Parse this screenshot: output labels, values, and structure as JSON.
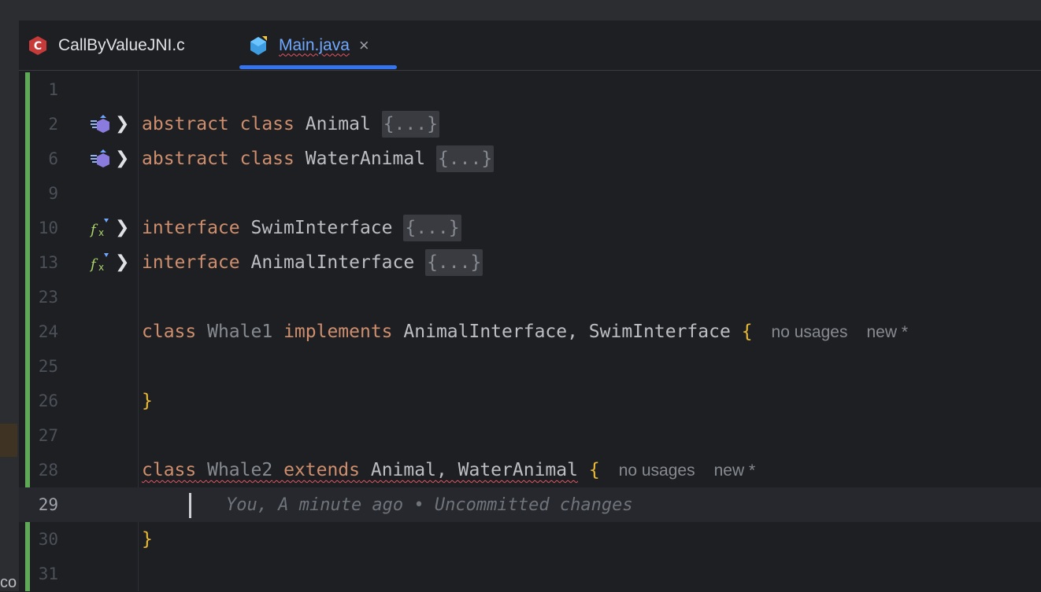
{
  "tabs": [
    {
      "label": "CallByValueJNI.c",
      "icon": "c-file-icon",
      "active": false
    },
    {
      "label": "Main.java",
      "icon": "java-file-icon",
      "active": true,
      "close_glyph": "×"
    }
  ],
  "left_strip": {
    "text": "co"
  },
  "editor": {
    "lines": [
      {
        "n": "1"
      },
      {
        "n": "2",
        "kw1": "abstract",
        "kw2": "class",
        "name": "Animal",
        "fold": "{...}"
      },
      {
        "n": "6",
        "kw1": "abstract",
        "kw2": "class",
        "name": "WaterAnimal",
        "fold": "{...}"
      },
      {
        "n": "9"
      },
      {
        "n": "10",
        "kw1": "interface",
        "name": "SwimInterface",
        "fold": "{...}"
      },
      {
        "n": "13",
        "kw1": "interface",
        "name": "AnimalInterface",
        "fold": "{...}"
      },
      {
        "n": "23"
      },
      {
        "n": "24",
        "kw1": "class",
        "name": "Whale1",
        "kw2": "implements",
        "rest": "AnimalInterface, SwimInterface",
        "brace": "{",
        "usages": "no usages",
        "status": "new *"
      },
      {
        "n": "25"
      },
      {
        "n": "26",
        "brace": "}"
      },
      {
        "n": "27"
      },
      {
        "n": "28",
        "kw1": "class",
        "name": "Whale2",
        "kw2": "extends",
        "rest": "Animal, WaterAnimal",
        "brace": "{",
        "usages": "no usages",
        "status": "new *"
      },
      {
        "n": "29",
        "blame": "You, A minute ago • Uncommitted changes"
      },
      {
        "n": "30",
        "brace": "}"
      },
      {
        "n": "31"
      }
    ]
  },
  "colors": {
    "accent": "#3574f0",
    "keyword": "#cf8e6d",
    "brace": "#e8ba36",
    "vcs_added": "#5fa858",
    "error": "#e55765"
  }
}
